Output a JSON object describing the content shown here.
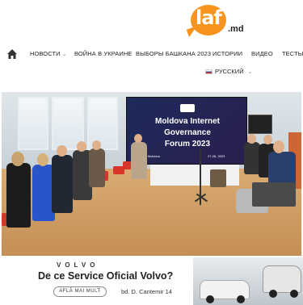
{
  "logo": {
    "text": "laf",
    "suffix": ".md",
    "color": "#f7941d"
  },
  "nav": {
    "home_icon": "home-icon",
    "items": [
      {
        "label": "НОВОСТИ",
        "dropdown": true
      },
      {
        "label": "ВОЙНА В УКРАИНЕ",
        "dropdown": false
      },
      {
        "label": "ВЫБОРЫ БАШКАНА 2023",
        "dropdown": false
      },
      {
        "label": "ИСТОРИИ",
        "dropdown": false
      },
      {
        "label": "ВИДЕО",
        "dropdown": false
      },
      {
        "label": "ТЕСТЫ",
        "dropdown": false
      }
    ],
    "language": {
      "label": "РУССКИЙ",
      "flag_icon": "russia-flag-icon"
    }
  },
  "photo": {
    "screen_line1": "Moldova Internet",
    "screen_line2": "Governance",
    "screen_line3": "Forum 2023",
    "screen_date": "27-28, 2023",
    "screen_location": "ra, Moldova"
  },
  "ad": {
    "brand": "VOLVO",
    "title": "De ce Service Oficial Volvo?",
    "button_label": "AFLĂ MAI MULT",
    "address": "bd. D. Cantemir 14"
  }
}
